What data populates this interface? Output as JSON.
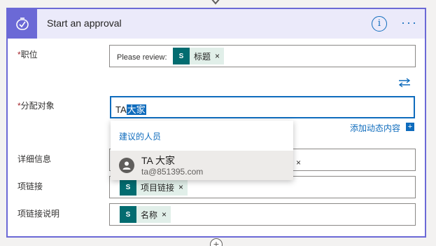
{
  "action": {
    "title": "Start an approval",
    "icons": {
      "header": "approval-check-icon",
      "info": "info-icon",
      "more": "more-options-icon"
    },
    "info_glyph": "i",
    "more_glyph": "···",
    "accent_color": "#6b69d6",
    "link_color": "#0f6cbd"
  },
  "fields": {
    "position": {
      "label": "职位",
      "required_mark": "*",
      "prefix_text": "Please review:",
      "token": {
        "label": "标题",
        "remove": "×",
        "icon": "sharepoint-icon"
      }
    },
    "assign_to": {
      "label": "分配对象",
      "required_mark": "*",
      "value_plain": "TA",
      "value_selected": "大家",
      "swap_icon": "swap-arrows-icon",
      "add_dynamic_label": "添加动态内容",
      "add_dynamic_plus": "+"
    },
    "details": {
      "label": "详细信息",
      "token_remove": "×"
    },
    "item_link": {
      "label": "项链接",
      "token": {
        "label": "项目链接",
        "remove": "×",
        "icon": "sharepoint-icon"
      }
    },
    "item_link_desc": {
      "label": "项链接说明",
      "token": {
        "label": "名称",
        "remove": "×",
        "icon": "sharepoint-icon"
      }
    }
  },
  "suggestions": {
    "header": "建议的人员",
    "items": [
      {
        "name": "TA 大家",
        "email": "ta@851395.com",
        "icon": "person-avatar-icon"
      }
    ]
  },
  "add_step_glyph": "+",
  "sp_glyph": "S"
}
